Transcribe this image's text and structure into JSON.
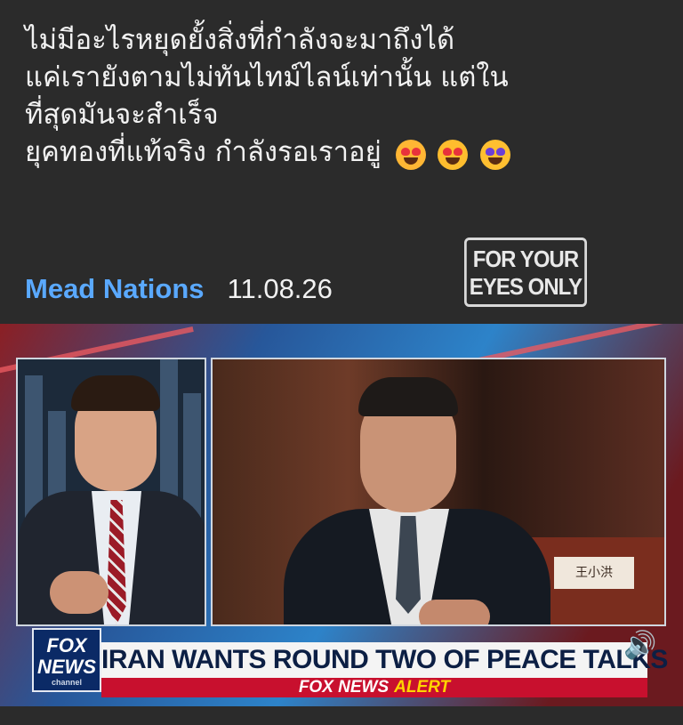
{
  "post": {
    "lines": [
      "ไม่มีอะไรหยุดยั้งสิ่งที่กำลังจะมาถึงได้",
      "แค่เรายังตามไม่ทันไทม์ไลน์เท่านั้น แต่ใน",
      "ที่สุดมันจะสำเร็จ",
      "ยุคทองที่แท้จริง กำลังรอเราอยู่"
    ],
    "emojis": [
      "smiling-face-with-hearts",
      "heart-eyes",
      "star-struck"
    ]
  },
  "meta": {
    "author": "Mead Nations",
    "date": "11.08.26"
  },
  "stamp": {
    "line1": "FOR YOUR",
    "line2": "EYES ONLY"
  },
  "video": {
    "logo_line1": "FOX",
    "logo_line2": "NEWS",
    "logo_sub": "channel",
    "headline": "IRAN WANTS ROUND TWO OF PEACE TALKS",
    "alert_brand": "FOX NEWS",
    "alert_word": "ALERT",
    "nameplate": "王小洪",
    "volume_icon": "speaker-icon"
  },
  "colors": {
    "background": "#2b2b2b",
    "author_link": "#5aa9ff",
    "alert_red": "#c8102e",
    "alert_yellow": "#ffd400",
    "fox_navy": "#0b2a66"
  }
}
